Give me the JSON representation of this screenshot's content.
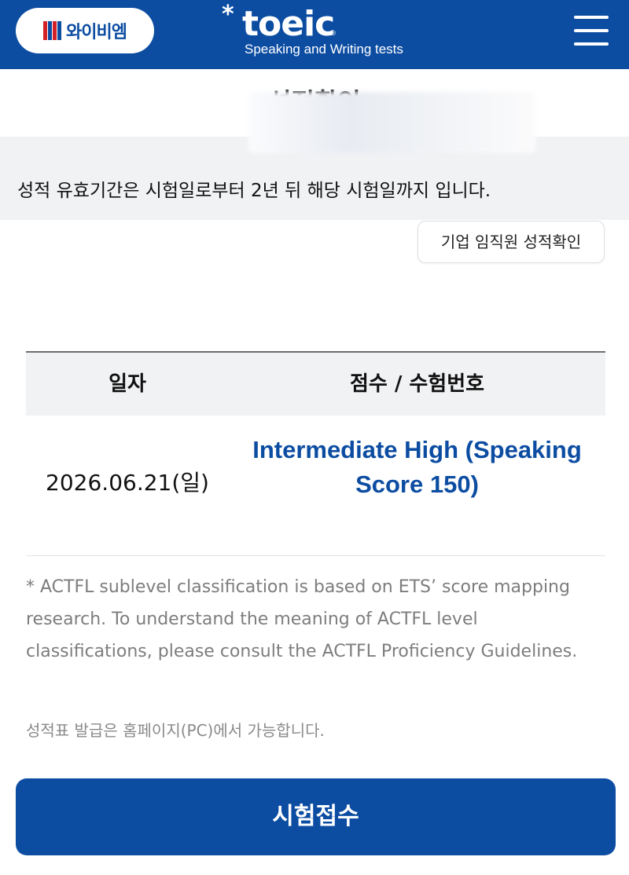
{
  "header": {
    "ybm_text": "와이비엠",
    "brand": {
      "star": "*",
      "name": "toeic",
      "registered": "®",
      "subtitle": "Speaking and Writing tests"
    },
    "icons": {
      "menu": "hamburger-menu-icon",
      "ybm_logo": "ybm-logo"
    },
    "colors": {
      "primary": "#0c4da2",
      "ybm_red": "#d42027"
    }
  },
  "page": {
    "title": "성적확인"
  },
  "notice": {
    "text": "성적 유효기간은 시험일로부터 2년 뒤 해당 시험일까지 입니다."
  },
  "corporate_button": {
    "label": "기업 임직원 성적확인"
  },
  "table": {
    "headers": {
      "date": "일자",
      "score": "점수 / 수험번호"
    },
    "rows": [
      {
        "date": "2026.06.21(일)",
        "score": "Intermediate High (Speaking Score 150)"
      }
    ]
  },
  "notes": {
    "actfl": "* ACTFL sublevel classification is based on ETS’ score mapping research. To understand the meaning of ACTFL level classifications, please consult the ACTFL Proficiency Guidelines.",
    "pc": "성적표 발급은 홈페이지(PC)에서 가능합니다."
  },
  "apply_button": {
    "label": "시험접수"
  }
}
